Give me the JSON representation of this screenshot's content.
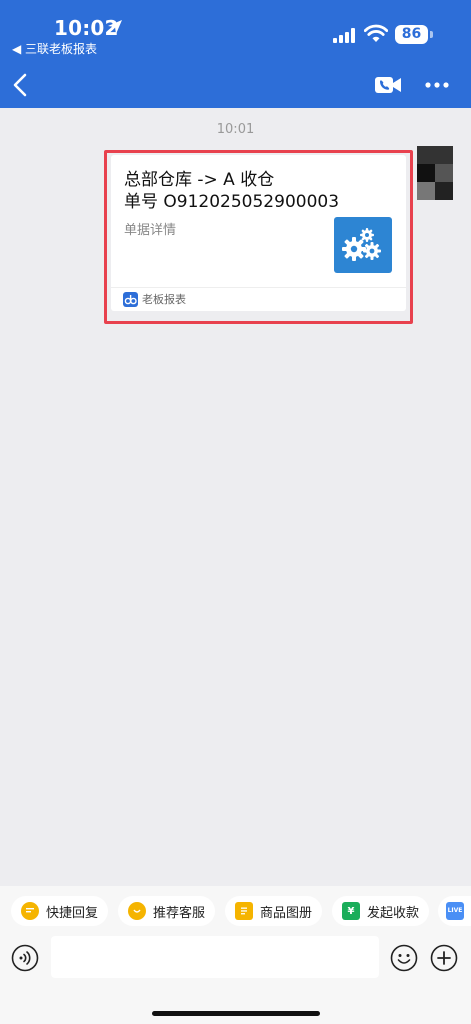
{
  "status_bar": {
    "time": "10:02",
    "back_app": "◀ 三联老板报表",
    "battery": "86"
  },
  "chat": {
    "timestamp": "10:01",
    "card": {
      "title": "总部仓库 -> A 收仓",
      "order": "单号 O912025052900003",
      "subtitle": "单据详情",
      "app_name": "老板报表"
    }
  },
  "quick_replies": [
    {
      "label": "快捷回复",
      "icon": "quick-reply-icon",
      "color": "#f5b400"
    },
    {
      "label": "推荐客服",
      "icon": "service-icon",
      "color": "#f5b400"
    },
    {
      "label": "商品图册",
      "icon": "catalog-icon",
      "color": "#f5b400"
    },
    {
      "label": "发起收款",
      "icon": "payment-icon",
      "color": "#1aad5a"
    }
  ],
  "quick_live": "LIVE",
  "input": {
    "placeholder": ""
  },
  "colors": {
    "header": "#2d6ed8",
    "highlight": "#e8414e",
    "card_icon": "#2d85d3"
  }
}
